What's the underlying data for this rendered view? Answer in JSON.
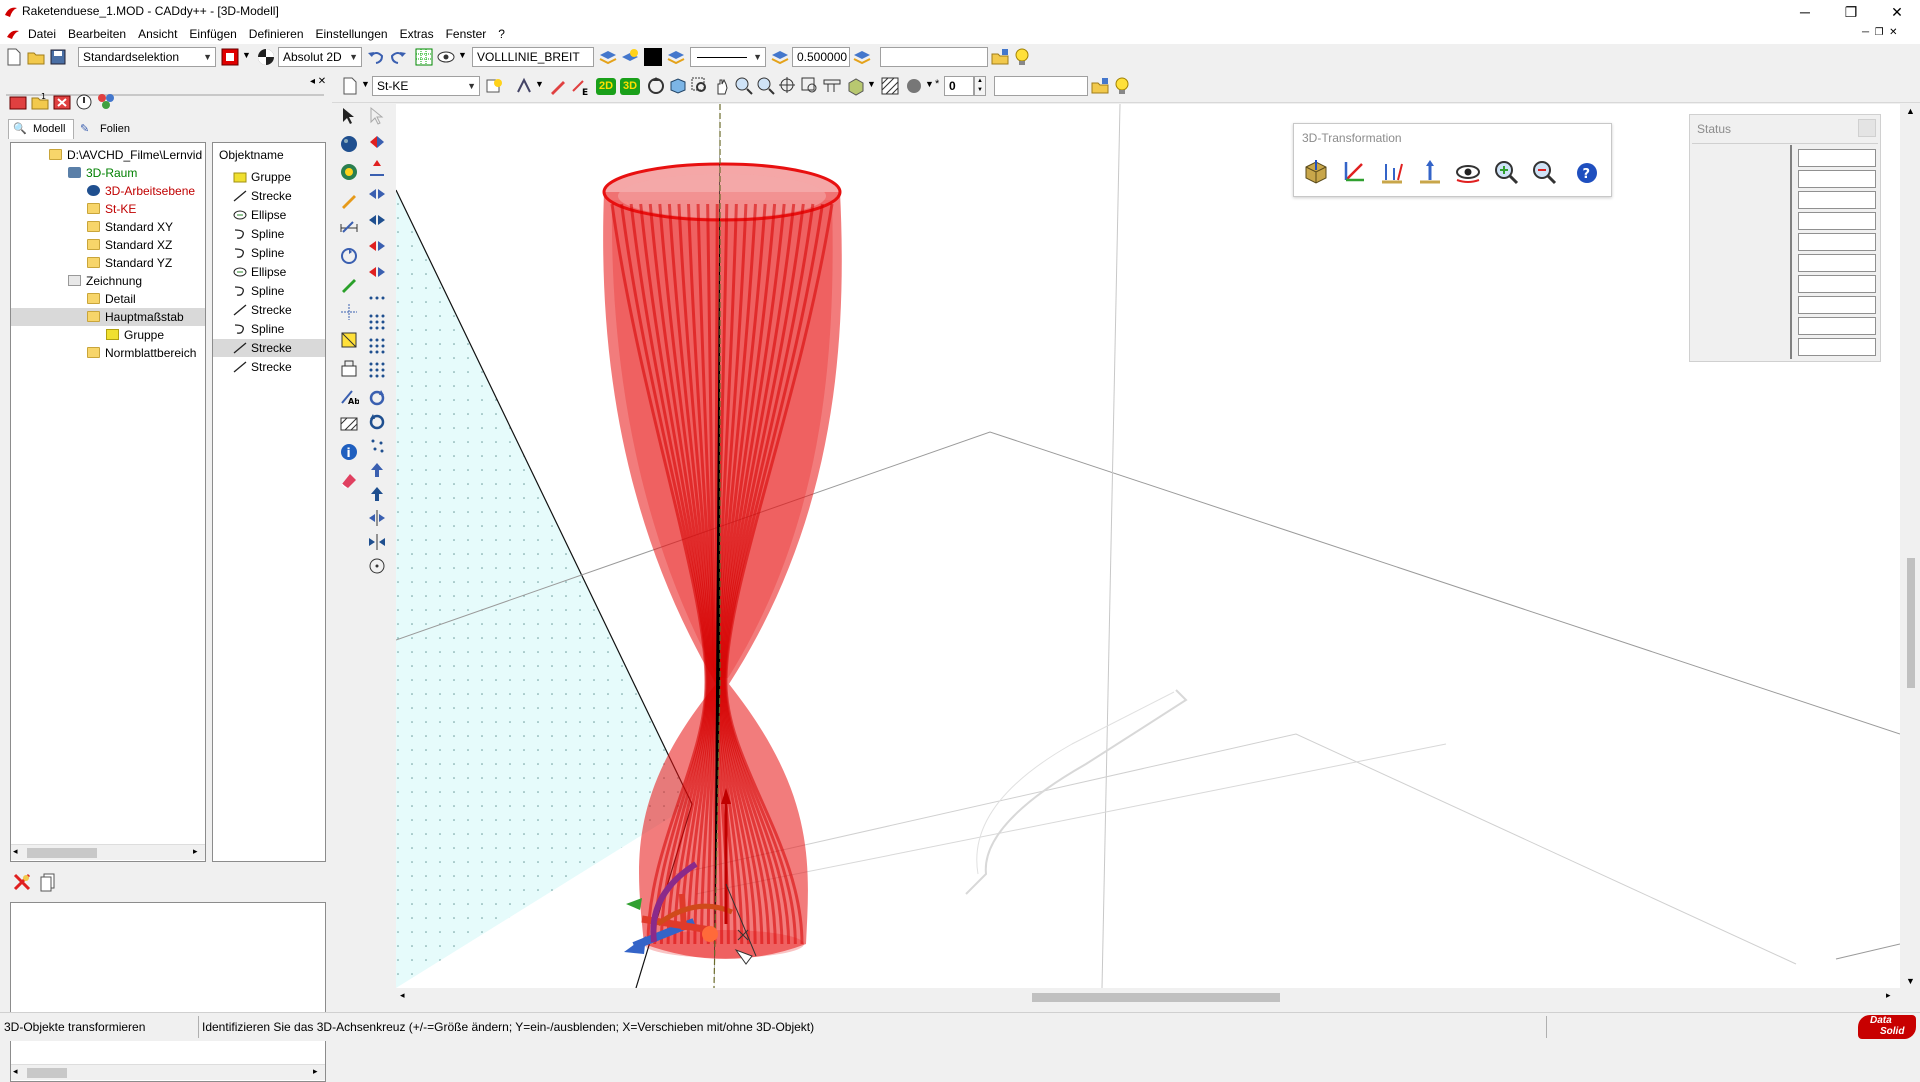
{
  "window": {
    "title": "Raketenduese_1.MOD  -  CADdy++ - [3D-Modell]",
    "minimize": "─",
    "restore": "❐",
    "close": "✕"
  },
  "menu": {
    "items": [
      "Datei",
      "Bearbeiten",
      "Ansicht",
      "Einfügen",
      "Definieren",
      "Einstellungen",
      "Extras",
      "Fenster",
      "?"
    ]
  },
  "toolbar1": {
    "selection_mode": "Standardselektion",
    "coord_mode": "Absolut 2D",
    "line_type": "VOLLLINIE_BREIT",
    "line_width": "0.500000",
    "empty_field": ""
  },
  "toolbar2": {
    "layer": "St-KE",
    "spin_value": "0",
    "empty_field": ""
  },
  "tabs": {
    "model": "Modell",
    "sheets": "Folien"
  },
  "tree": {
    "root": "D:\\AVCHD_Filme\\Lernvid",
    "items": [
      {
        "label": "3D-Raum",
        "style": "green"
      },
      {
        "label": "3D-Arbeitsebene",
        "style": "red"
      },
      {
        "label": "St-KE",
        "style": "red"
      },
      {
        "label": "Standard XY",
        "style": "normal"
      },
      {
        "label": "Standard XZ",
        "style": "normal"
      },
      {
        "label": "Standard YZ",
        "style": "normal"
      },
      {
        "label": "Zeichnung",
        "style": "normal"
      },
      {
        "label": "Detail",
        "style": "normal"
      },
      {
        "label": "Hauptmaßstab",
        "style": "selected"
      },
      {
        "label": "Gruppe",
        "style": "normal"
      },
      {
        "label": "Normblattbereich",
        "style": "normal"
      }
    ]
  },
  "objects": {
    "header": "Objektname",
    "items": [
      {
        "label": "Gruppe",
        "icon": "group"
      },
      {
        "label": "Strecke",
        "icon": "line"
      },
      {
        "label": "Ellipse",
        "icon": "ellipse"
      },
      {
        "label": "Spline",
        "icon": "spline"
      },
      {
        "label": "Spline",
        "icon": "spline"
      },
      {
        "label": "Ellipse",
        "icon": "ellipse"
      },
      {
        "label": "Spline",
        "icon": "spline"
      },
      {
        "label": "Strecke",
        "icon": "line"
      },
      {
        "label": "Spline",
        "icon": "spline"
      },
      {
        "label": "Strecke",
        "icon": "line",
        "selected": true
      },
      {
        "label": "Strecke",
        "icon": "line"
      }
    ]
  },
  "transform_window": {
    "title": "3D-Transformation"
  },
  "status_window": {
    "title": "Status"
  },
  "statusbar": {
    "left": "3D-Objekte transformieren",
    "message": "Identifizieren Sie das 3D-Achsenkreuz (+/-=Größe ändern; Y=ein-/ausblenden; X=Verschieben mit/ohne 3D-Objekt)"
  },
  "logo": {
    "line1": "Data",
    "line2": "Solid"
  },
  "colors": {
    "accent_red": "#e00000",
    "model_red": "#e81010",
    "plane_cyan": "#e6fbfb",
    "selection_gray": "#d9d9d9"
  }
}
